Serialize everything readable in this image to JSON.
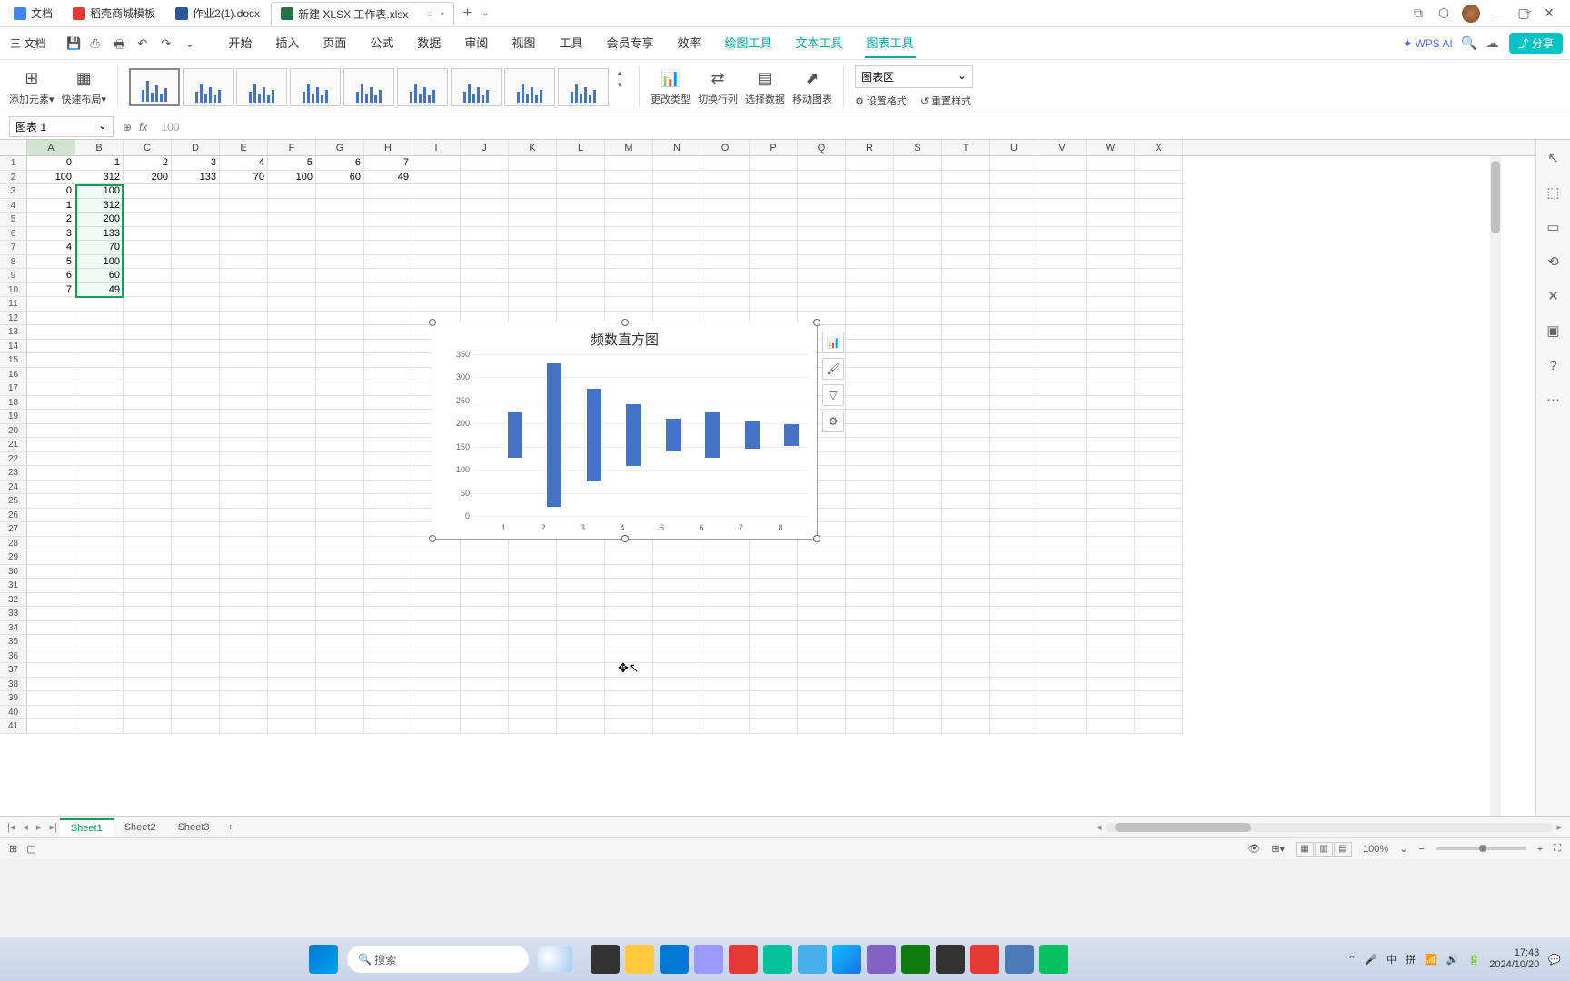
{
  "titlebar": {
    "tabs": [
      {
        "icon": "doc",
        "label": "文档"
      },
      {
        "icon": "dang",
        "label": "稻壳商城模板"
      },
      {
        "icon": "word",
        "label": "作业2(1).docx"
      },
      {
        "icon": "xls",
        "label": "新建 XLSX 工作表.xlsx",
        "active": true
      }
    ],
    "add": "+",
    "chev": "⌄"
  },
  "menubar": {
    "menu_btn": "三 文档",
    "tabs": [
      "开始",
      "插入",
      "页面",
      "公式",
      "数据",
      "审阅",
      "视图",
      "工具",
      "会员专享",
      "效率"
    ],
    "teal_tabs": [
      "绘图工具",
      "文本工具"
    ],
    "active_tab": "图表工具",
    "wps_ai": "WPS AI",
    "share": "⤴ 分享"
  },
  "ribbon": {
    "add_element": "添加元素▾",
    "quick_layout": "快速布局▾",
    "change_type": "更改类型",
    "switch_rc": "切换行列",
    "select_data": "选择数据",
    "move_chart": "移动图表",
    "set_format": "设置格式",
    "reset_style": "重置样式",
    "element_select": "图表区"
  },
  "namebox": {
    "name": "图表 1",
    "fx_value": "100"
  },
  "columns": [
    "A",
    "B",
    "C",
    "D",
    "E",
    "F",
    "G",
    "H",
    "I",
    "J",
    "K",
    "L",
    "M",
    "N",
    "O",
    "P",
    "Q",
    "R",
    "S",
    "T",
    "U",
    "V",
    "W",
    "X"
  ],
  "row_count": 41,
  "cells": {
    "r1": [
      "0",
      "1",
      "2",
      "3",
      "4",
      "5",
      "6",
      "7"
    ],
    "r2": [
      "100",
      "312",
      "200",
      "133",
      "70",
      "100",
      "60",
      "49"
    ],
    "colA": [
      "0",
      "1",
      "2",
      "3",
      "4",
      "5",
      "6",
      "7"
    ],
    "colB": [
      "100",
      "312",
      "200",
      "133",
      "70",
      "100",
      "60",
      "49"
    ]
  },
  "chart_data": {
    "type": "bar",
    "title": "频数直方图",
    "categories": [
      "1",
      "2",
      "3",
      "4",
      "5",
      "6",
      "7",
      "8"
    ],
    "values": [
      100,
      312,
      200,
      133,
      70,
      100,
      60,
      49
    ],
    "ylim": [
      0,
      350
    ],
    "yticks": [
      0,
      50,
      100,
      150,
      200,
      250,
      300,
      350
    ],
    "xlabel": "",
    "ylabel": ""
  },
  "sheets": {
    "tabs": [
      "Sheet1",
      "Sheet2",
      "Sheet3"
    ],
    "active": "Sheet1"
  },
  "statusbar": {
    "zoom": "100%"
  },
  "taskbar": {
    "search_placeholder": "搜索",
    "ime": "中",
    "pinyin": "拼",
    "time": "17:43",
    "date": "2024/10/20"
  }
}
